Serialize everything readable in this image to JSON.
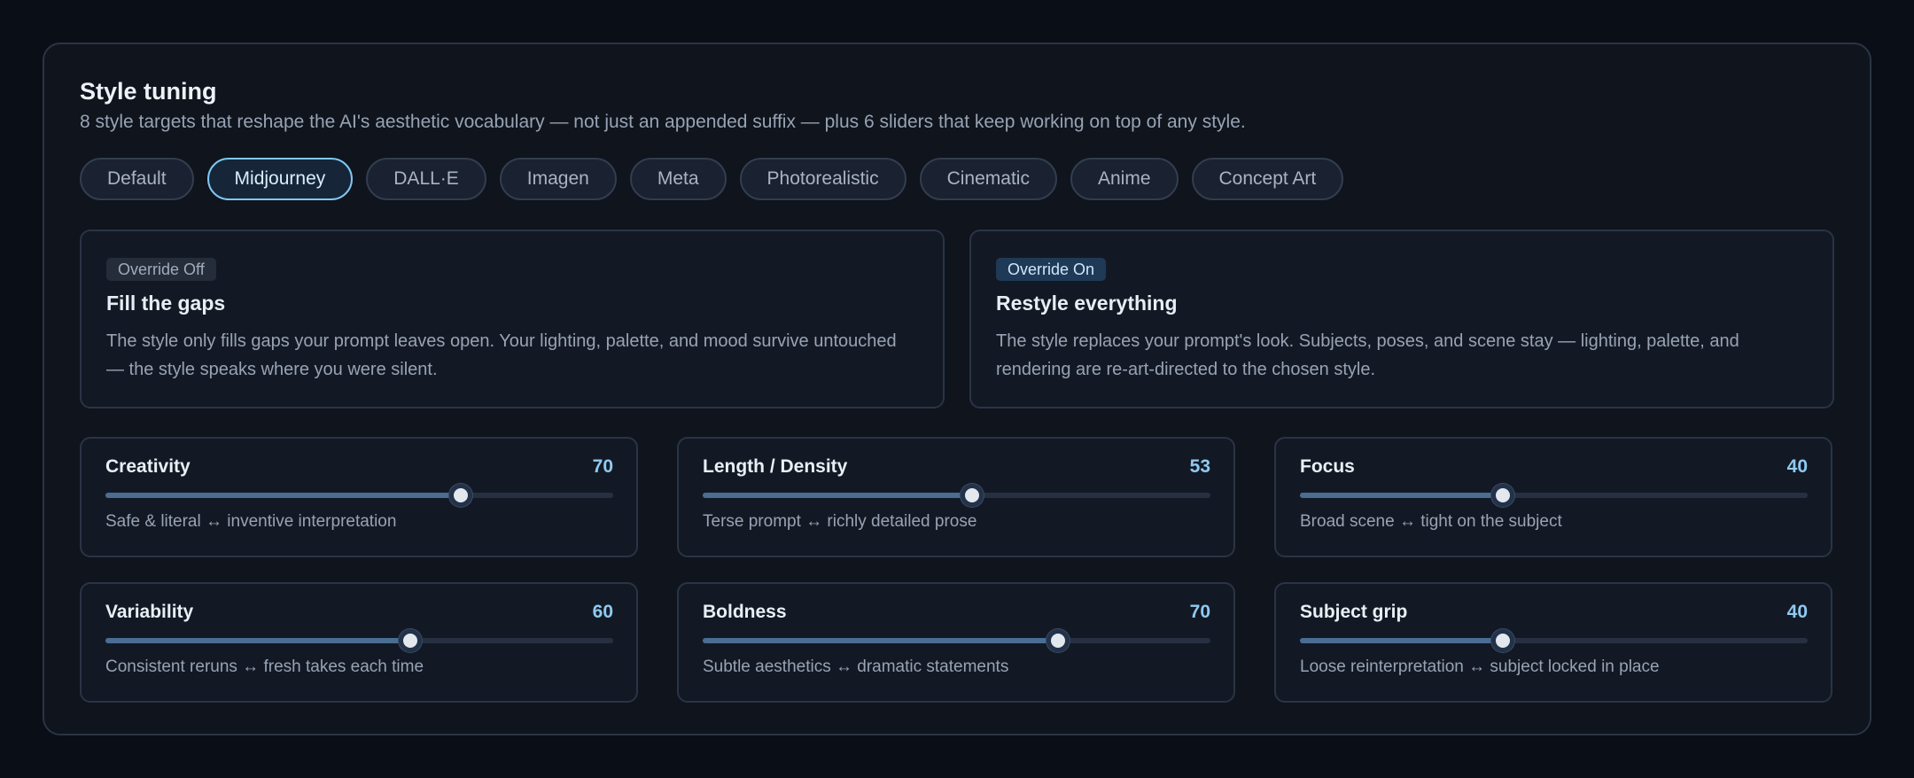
{
  "header": {
    "title": "Style tuning",
    "subtitle": "8 style targets that reshape the AI's aesthetic vocabulary — not just an appended suffix — plus 6 sliders that keep working on top of any style."
  },
  "styles": {
    "selected": "Midjourney",
    "items": [
      "Default",
      "Midjourney",
      "DALL·E",
      "Imagen",
      "Meta",
      "Photorealistic",
      "Cinematic",
      "Anime",
      "Concept Art"
    ]
  },
  "modes": [
    {
      "badge": "Override Off",
      "title": "Fill the gaps",
      "description": "The style only fills gaps your prompt leaves open. Your lighting, palette, and mood survive untouched — the style speaks where you were silent."
    },
    {
      "badge": "Override On",
      "title": "Restyle everything",
      "description": "The style replaces your prompt's look. Subjects, poses, and scene stay — lighting, palette, and rendering are re-art-directed to the chosen style."
    }
  ],
  "sliders": [
    {
      "label": "Creativity",
      "value": 70,
      "description": "Safe & literal ↔ inventive interpretation"
    },
    {
      "label": "Length / Density",
      "value": 53,
      "description": "Terse prompt ↔ richly detailed prose"
    },
    {
      "label": "Focus",
      "value": 40,
      "description": "Broad scene ↔ tight on the subject"
    },
    {
      "label": "Variability",
      "value": 60,
      "description": "Consistent reruns ↔ fresh takes each time"
    },
    {
      "label": "Boldness",
      "value": 70,
      "description": "Subtle aesthetics ↔ dramatic statements"
    },
    {
      "label": "Subject grip",
      "value": 40,
      "description": "Loose reinterpretation ↔ subject locked in place"
    }
  ],
  "colors": {
    "accent": "#7fc8f3",
    "value_text": "#8fcaf2",
    "slider_fill": "#4a6d94"
  }
}
